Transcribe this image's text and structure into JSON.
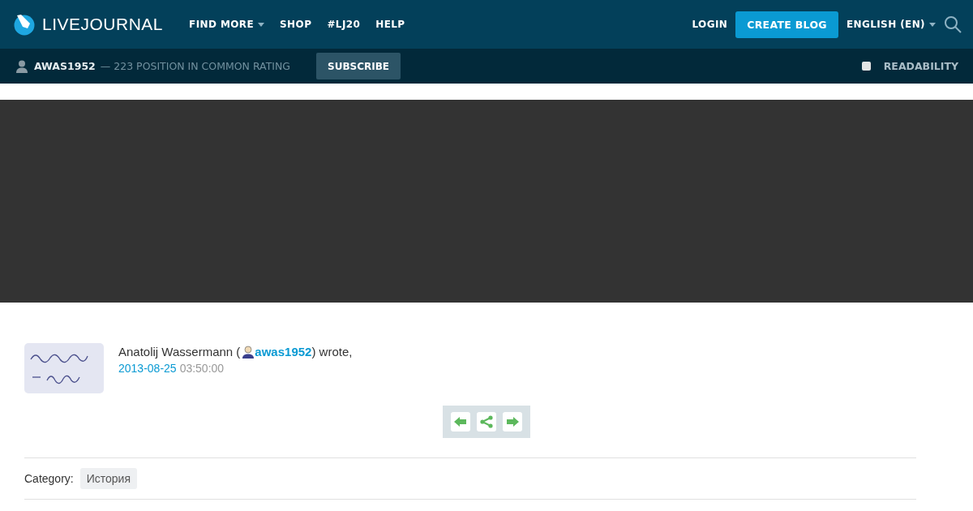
{
  "header": {
    "logo": "LIVEJOURNAL",
    "nav": [
      {
        "label": "FIND MORE",
        "dropdown": true
      },
      {
        "label": "SHOP",
        "dropdown": false
      },
      {
        "label": "#LJ20",
        "dropdown": false
      },
      {
        "label": "HELP",
        "dropdown": false
      }
    ],
    "login": "LOGIN",
    "create_blog": "CREATE BLOG",
    "language": "ENGLISH (EN)"
  },
  "subbar": {
    "username": "AWAS1952",
    "rating": "— 223 POSITION IN COMMON RATING",
    "subscribe": "SUBSCRIBE",
    "readability": {
      "label": "READABILITY",
      "checked": false
    }
  },
  "post": {
    "author": "Anatolij Wassermann (",
    "user": "awas1952",
    "wrote": ") wrote,",
    "date": "2013-08-25",
    "time": "03:50:00"
  },
  "category": {
    "label": "Category:",
    "tags": [
      "История"
    ]
  }
}
